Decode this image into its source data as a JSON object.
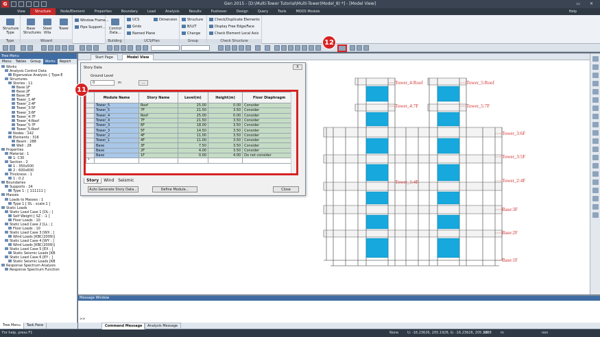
{
  "app": {
    "title": "Gen 2015 - [D:\\Multi-Tower Tutorial\\Multi-Tower(Model_8) *] - [Model View]",
    "logo": "G"
  },
  "menu": [
    "View",
    "Structure",
    "Node/Element",
    "Properties",
    "Boundary",
    "Load",
    "Analysis",
    "Results",
    "Pushover",
    "Design",
    "Query",
    "Tools",
    "MODS Module"
  ],
  "menu_active": "Structure",
  "help_label": "Help",
  "ribbon": {
    "groups": [
      {
        "name": "Type",
        "items": [
          "Structure Type"
        ]
      },
      {
        "name": "Wizard",
        "items": [
          "Base Structures",
          "Steel Villa",
          "Tower"
        ]
      },
      {
        "name": "",
        "items": [
          "Window Frame...",
          "Pipe Support..."
        ]
      },
      {
        "name": "Building",
        "items": [
          "Control Data..."
        ]
      },
      {
        "name": "UCS/Plan",
        "items": [
          "UCS",
          "Dimension",
          "Grids",
          "Named Plane"
        ]
      },
      {
        "name": "Group",
        "items": [
          "Structure",
          "B/U/T",
          "Change"
        ]
      },
      {
        "name": "Check Structure",
        "items": [
          "Check/Duplicate Elements",
          "Display Free Edge/Face",
          "Check Element Local Axis"
        ]
      }
    ]
  },
  "badges": {
    "b11": "11",
    "b12": "12"
  },
  "tree": {
    "header": "Tree Menu",
    "tabs": [
      "Menu",
      "Tables",
      "Group",
      "Works",
      "Report"
    ],
    "active_tab": "Works",
    "items": [
      "Works",
      "Analysis Control Data",
      "Eigenvalue Analysis { Type:E",
      "Structures",
      "Stories : 11",
      "Base:1F",
      "Base:2F",
      "Base:3F",
      "Tower_1:4F",
      "Tower_2:4F",
      "Tower_3:5F",
      "Tower_3:6F",
      "Tower_4:7F",
      "Tower_4:Roof",
      "Tower_5:7F",
      "Tower_5:Roof",
      "Nodes : 142",
      "Elements : 316",
      "Beam : 288",
      "Wall : 28",
      "Properties",
      "Material : 1",
      "1: C30",
      "Section : 2",
      "1 : 350x500",
      "2 : 600x600",
      "Thickness : 1",
      "1 : 0.2",
      "Boundaries",
      "Supports : 24",
      "Type 1 : [ 111111 ]",
      "Masses",
      "Loads to Masses : 1",
      "Type 1 [ DL : scale:1 ]",
      "Static Loads",
      "Static Load Case 1 [DL ; ]",
      "Self Weight [ SZ : -1 ]",
      "Floor Loads : 10",
      "Static Load Case 2 [LL ; ]",
      "Floor Loads : 10",
      "Static Load Case 3 [WX ; ]",
      "Wind Loads [KBC(2009)]",
      "Static Load Case 4 [WY ; ]",
      "Wind Loads [KBC(2009)]",
      "Static Load Case 5 [EX ; ]",
      "Static Seismic Loads [KB",
      "Static Load Case 6 [EY ; ]",
      "Static Seismic Loads [KB",
      "Response Spectrum Analysis",
      "Response Spectrum Function"
    ],
    "bottom_tabs": [
      "Tree Menu",
      "Task Pane"
    ]
  },
  "doc_tabs": [
    "Start Page",
    "Model View"
  ],
  "dialog": {
    "title": "Story Data",
    "ground_level_label": "Ground Level",
    "ground_level_value": "0",
    "ground_unit": "m",
    "ground_btn": "...",
    "columns": [
      "Module Name",
      "Story Name",
      "Level(m)",
      "Height(m)",
      "Floor Diaphragm"
    ],
    "rows": [
      [
        "Tower_5",
        "Roof",
        "25.00",
        "0.00",
        "Consider"
      ],
      [
        "Tower_5",
        "7F",
        "21.50",
        "3.50",
        "Consider"
      ],
      [
        "Tower_4",
        "Roof",
        "25.00",
        "0.00",
        "Consider"
      ],
      [
        "Tower_4",
        "7F",
        "21.50",
        "3.50",
        "Consider"
      ],
      [
        "Tower_3",
        "6F",
        "18.00",
        "3.50",
        "Consider"
      ],
      [
        "Tower_3",
        "5F",
        "14.50",
        "3.50",
        "Consider"
      ],
      [
        "Tower_2",
        "4F",
        "11.00",
        "3.50",
        "Consider"
      ],
      [
        "Tower_1",
        "4F",
        "11.00",
        "3.50",
        "Consider"
      ],
      [
        "Base",
        "3F",
        "7.50",
        "3.50",
        "Consider"
      ],
      [
        "Base",
        "2F",
        "4.00",
        "3.50",
        "Consider"
      ],
      [
        "Base",
        "1F",
        "0.00",
        "4.00",
        "Do not consider"
      ]
    ],
    "new_row_marker": "*",
    "tabs": [
      "Story",
      "Wind",
      "Seismic"
    ],
    "active_tab": "Story",
    "buttons": {
      "auto": "Auto Generate Story Data...",
      "define": "Define Module...",
      "close": "Close"
    },
    "close_x": "X"
  },
  "model_labels": [
    "Tower_4:Roof",
    "Tower_5:Roof",
    "Tower_4:7F",
    "Tower_5:7F",
    "Tower_3:6F",
    "Tower_3:5F",
    "Tower_1:4F",
    "Tower_2:4F",
    "Base:3F",
    "Base:2F",
    "Base:1F"
  ],
  "message_window": {
    "title": "Message Window",
    "prompt": ">>",
    "tabs": [
      "Command Message",
      "Analysis Message"
    ]
  },
  "status": {
    "help": "For help, press F1",
    "node": "None",
    "coords": "U: -16.23626, 205.1928, G: -16.23626, 205.1928",
    "unit1": "kN",
    "unit2": "m",
    "mode": "non"
  },
  "colors": {
    "accent": "#c62828",
    "titlebar": "#3a4452",
    "tree_header": "#3f6ca3",
    "module_cell": "#a9c7e8",
    "story_cell": "#c4dcc4",
    "slab": "#17a9dd",
    "label": "#d32f2f"
  }
}
